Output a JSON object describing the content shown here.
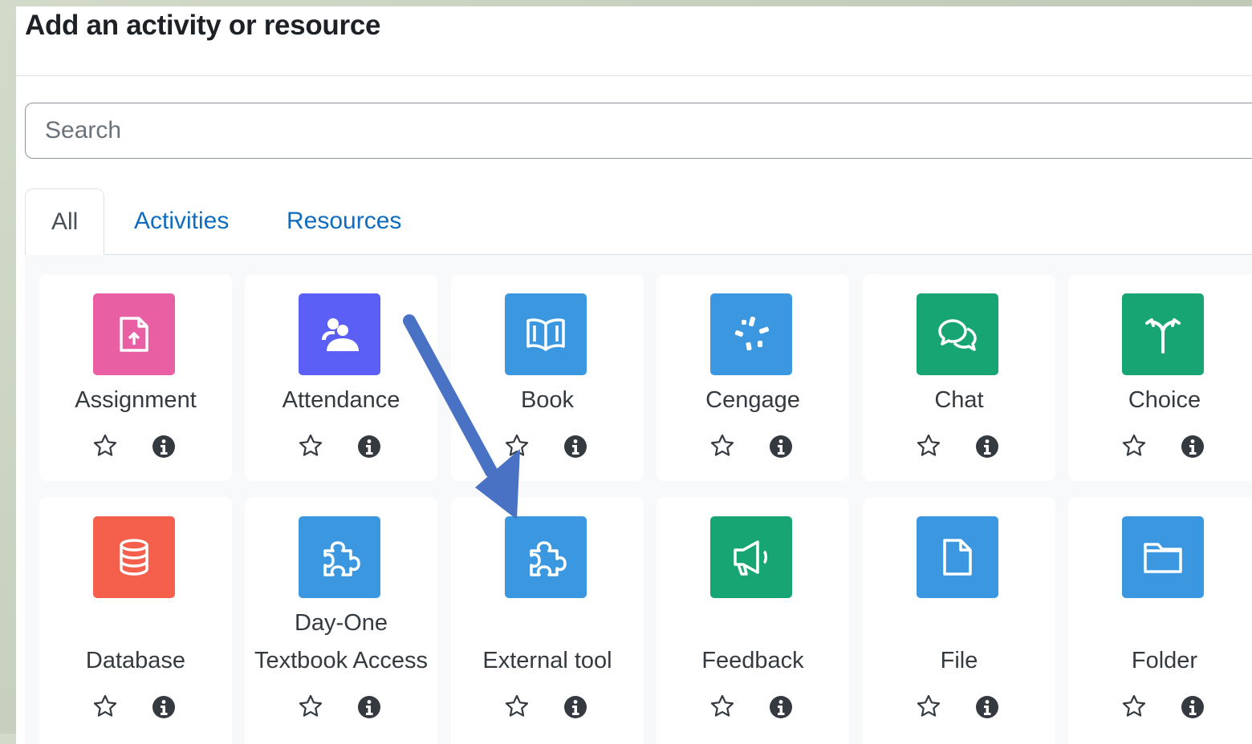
{
  "modal": {
    "title": "Add an activity or resource",
    "close_glyph": "×"
  },
  "search": {
    "placeholder": "Search"
  },
  "tabs": [
    {
      "label": "All",
      "active": true
    },
    {
      "label": "Activities",
      "active": false
    },
    {
      "label": "Resources",
      "active": false
    }
  ],
  "modules": [
    {
      "name": "Assignment",
      "icon": "assignment-icon",
      "color": "#e85fa4"
    },
    {
      "name": "Attendance",
      "icon": "attendance-icon",
      "color": "#5c5ff6"
    },
    {
      "name": "Book",
      "icon": "book-icon",
      "color": "#3b98e0"
    },
    {
      "name": "Cengage",
      "icon": "cengage-icon",
      "color": "#3b98e0"
    },
    {
      "name": "Chat",
      "icon": "chat-icon",
      "color": "#17a673"
    },
    {
      "name": "Choice",
      "icon": "choice-icon",
      "color": "#17a673"
    },
    {
      "name": "Database",
      "icon": "database-icon",
      "color": "#f4604b"
    },
    {
      "name": "Day-One",
      "name2": "Textbook Access",
      "icon": "puzzle-icon",
      "color": "#3b98e0"
    },
    {
      "name": "External tool",
      "icon": "puzzle-icon",
      "color": "#3b98e0"
    },
    {
      "name": "Feedback",
      "icon": "megaphone-icon",
      "color": "#17a673"
    },
    {
      "name": "File",
      "icon": "file-icon",
      "color": "#3b98e0"
    },
    {
      "name": "Folder",
      "icon": "folder-icon",
      "color": "#3b98e0"
    }
  ],
  "annotation": {
    "arrow_color": "#4a72c4"
  }
}
